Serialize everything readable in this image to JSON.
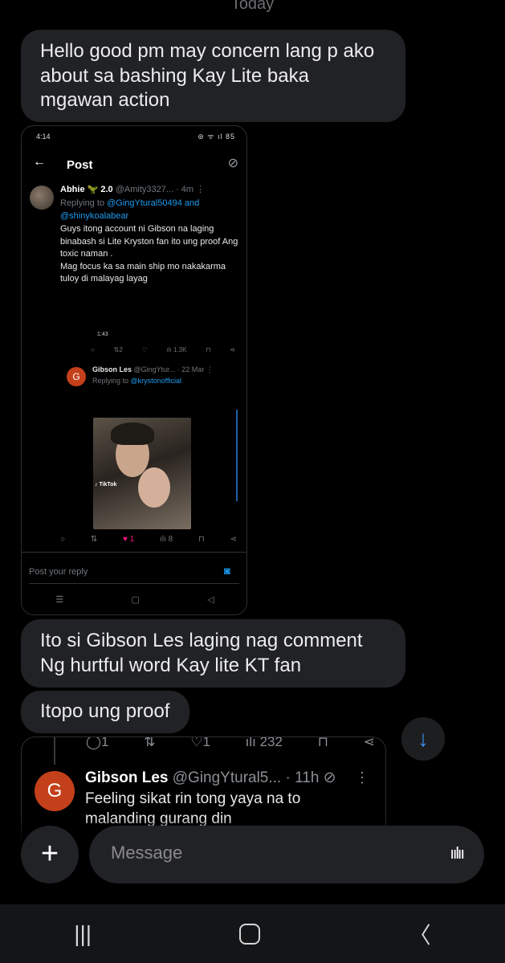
{
  "date_label": "Today",
  "messages": [
    "Hello good pm may concern lang p ako about sa bashing Kay Lite baka mgawan action",
    "Ito si Gibson Les laging nag comment Ng hurtful word Kay lite KT fan",
    "Itopo ung proof"
  ],
  "screenshot": {
    "status_time": "4:14",
    "status_icons": "⊚ ᯤ ıl 85",
    "header_title": "Post",
    "tweet1": {
      "name": "Abhie 🦖 2.0",
      "handle_time": "@Amity3327... · 4m",
      "replying_prefix": "Replying to ",
      "replying_to": "@GingYtural50494 and @shinykoalabear",
      "body": "Guys itong account ni Gibson na laging binabash si Lite Kryston fan ito ung proof Ang toxic naman .\nMag focus ka sa main ship mo nakakarma tuloy di malayag layag",
      "video_time": "1:43",
      "actions": [
        "○",
        "⇅2",
        "♡",
        "ılı 1.3K",
        "⊓",
        "⋖"
      ]
    },
    "tweet2": {
      "avatar_letter": "G",
      "name": "Gibson Les",
      "handle_time": "@GingYtur... · 22 Mar",
      "replying_prefix": "Replying to ",
      "replying_to": "@krystonofficial",
      "tiktok_label": "♪ TikTok",
      "actions": {
        "reply": "○",
        "repost": "⇅",
        "likes": "♥ 1",
        "views": "ılı 8",
        "bookmark": "⊓",
        "share": "⋖"
      }
    },
    "reply_placeholder": "Post your reply",
    "nav": [
      "☰",
      "▢",
      "◁"
    ]
  },
  "tweet_card": {
    "actions": [
      "◯1",
      "⇅",
      "♡1",
      "ılı 232",
      "⊓",
      "⋖"
    ],
    "avatar_letter": "G",
    "name": "Gibson Les",
    "handle_time": "@GingYtural5... · 11h",
    "text": "Feeling sikat rin tong yaya na to malanding gurang din"
  },
  "composer": {
    "plus": "+",
    "placeholder": "Message",
    "voice": "ıılıı"
  },
  "system_nav": {
    "recents": "|||",
    "back": "〈"
  }
}
